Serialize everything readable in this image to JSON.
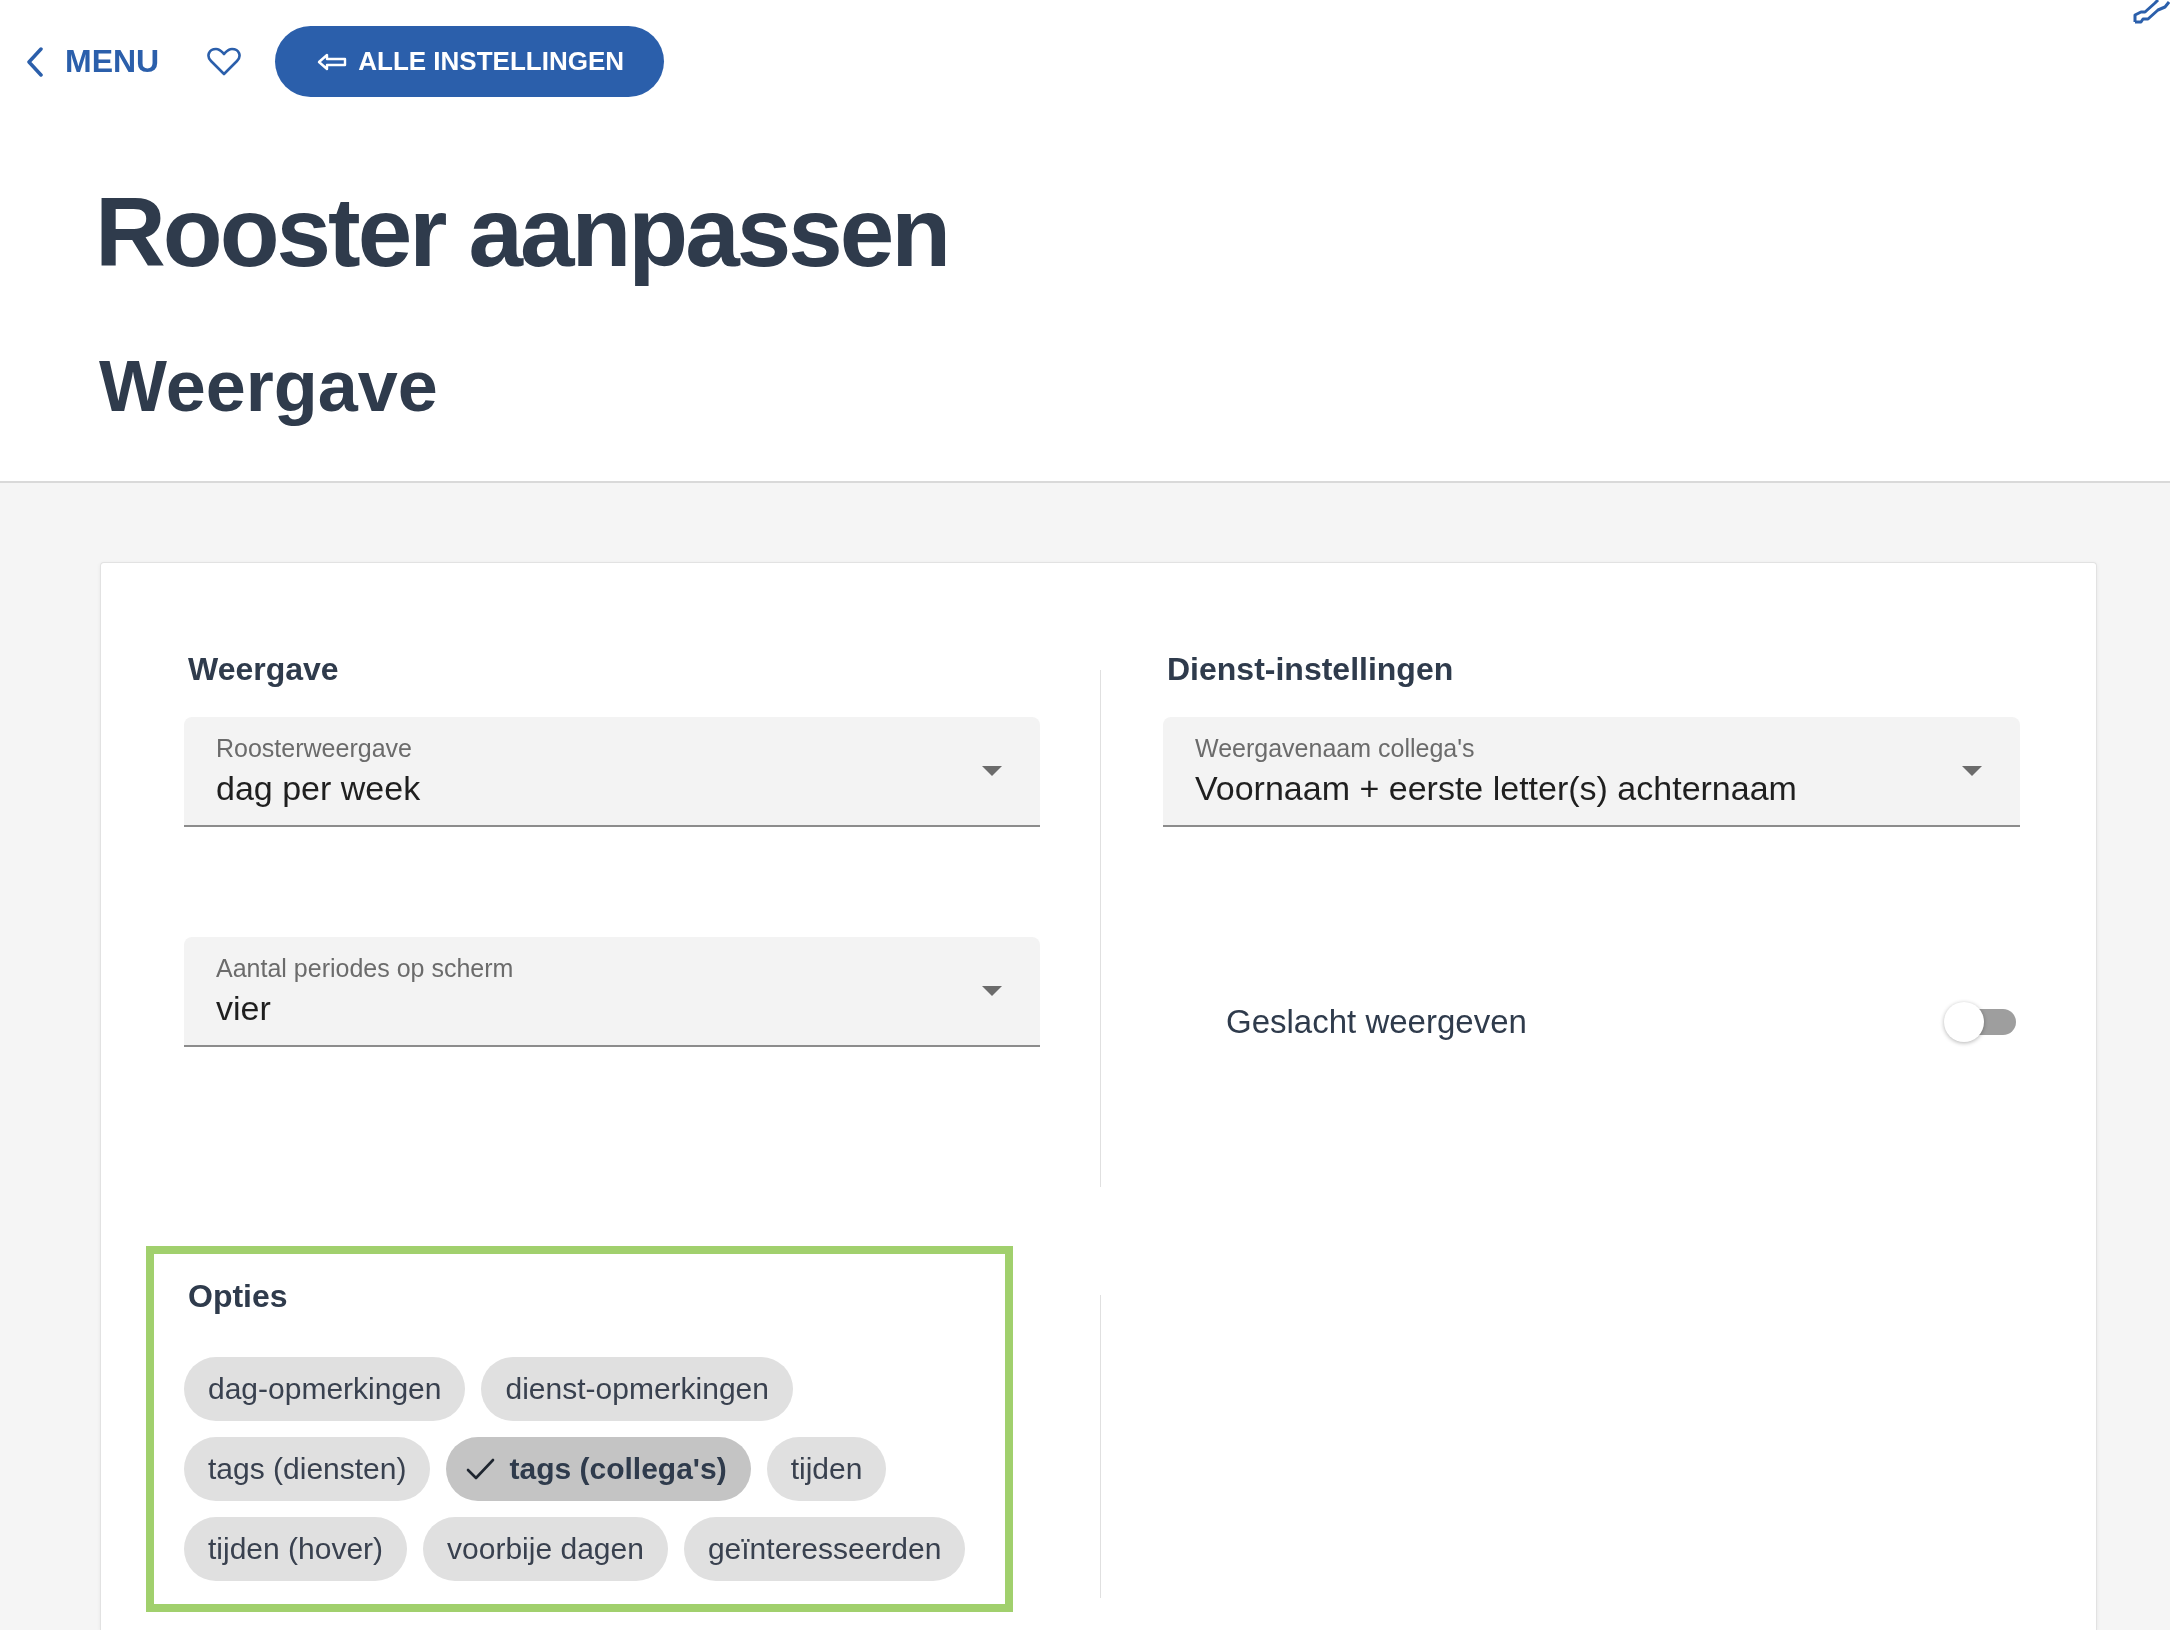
{
  "top_bar": {
    "back_link": "MENU",
    "favorite": false,
    "button": "ALLE INSTELLINGEN"
  },
  "title": "Rooster aanpassen",
  "subtitle": "Weergave",
  "panels": [
    {
      "heading": "Weergave",
      "controls": [
        {
          "kind": "select",
          "label": "Roosterweergave",
          "value": "dag per week"
        },
        {
          "kind": "select",
          "label": "Aantal periodes op scherm",
          "value": "vier"
        }
      ]
    },
    {
      "heading": "Dienst-instellingen",
      "controls": [
        {
          "kind": "select",
          "label": "Weergavenaam collega's",
          "value": "Voornaam + eerste letter(s) achternaam"
        },
        {
          "kind": "switch",
          "label": "Geslacht weergeven",
          "on": false
        }
      ]
    }
  ],
  "options": {
    "heading": "Opties",
    "highlighted": true,
    "chips": [
      {
        "label": "dag-opmerkingen",
        "selected": false
      },
      {
        "label": "dienst-opmerkingen",
        "selected": false
      },
      {
        "label": "tags (diensten)",
        "selected": false
      },
      {
        "label": "tags (collega's)",
        "selected": true
      },
      {
        "label": "tijden",
        "selected": false
      },
      {
        "label": "tijden (hover)",
        "selected": false
      },
      {
        "label": "voorbije dagen",
        "selected": false
      },
      {
        "label": "geïnteresseerden",
        "selected": false
      }
    ]
  }
}
